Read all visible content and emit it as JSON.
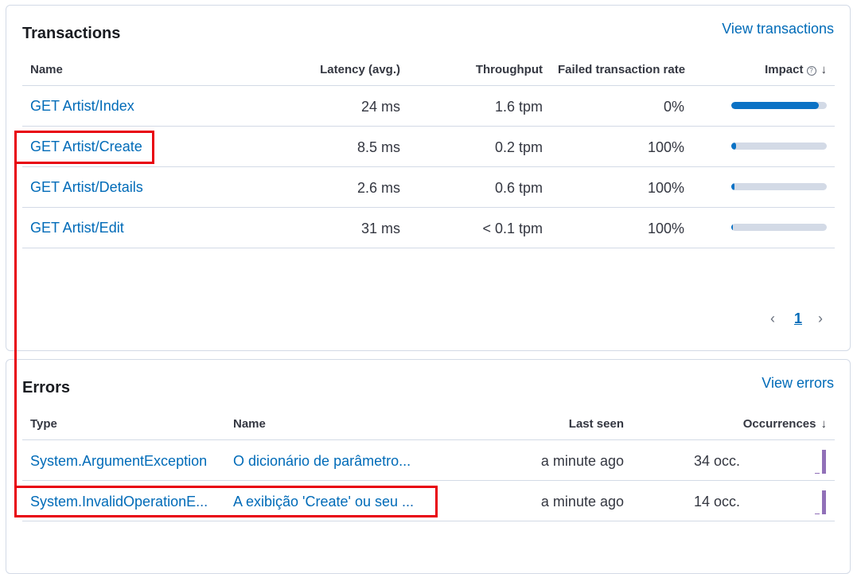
{
  "transactions": {
    "title": "Transactions",
    "view_link": "View transactions",
    "columns": {
      "name": "Name",
      "latency": "Latency (avg.)",
      "throughput": "Throughput",
      "failed_rate": "Failed transaction rate",
      "impact": "Impact"
    },
    "rows": [
      {
        "name": "GET Artist/Index",
        "latency": "24 ms",
        "throughput": "1.6 tpm",
        "failed_rate": "0%",
        "impact": 0.92
      },
      {
        "name": "GET Artist/Create",
        "latency": "8.5 ms",
        "throughput": "0.2 tpm",
        "failed_rate": "100%",
        "impact": 0.05
      },
      {
        "name": "GET Artist/Details",
        "latency": "2.6 ms",
        "throughput": "0.6 tpm",
        "failed_rate": "100%",
        "impact": 0.03
      },
      {
        "name": "GET Artist/Edit",
        "latency": "31 ms",
        "throughput": "< 0.1 tpm",
        "failed_rate": "100%",
        "impact": 0.01
      }
    ],
    "pagination": {
      "current_page": "1"
    }
  },
  "errors": {
    "title": "Errors",
    "view_link": "View errors",
    "columns": {
      "type": "Type",
      "name": "Name",
      "last_seen": "Last seen",
      "occurrences": "Occurrences"
    },
    "rows": [
      {
        "type": "System.ArgumentException",
        "name": "O dicionário de parâmetro...",
        "last_seen": "a minute ago",
        "occurrences": "34 occ."
      },
      {
        "type": "System.InvalidOperationE...",
        "name": "A exibição 'Create' ou seu ...",
        "last_seen": "a minute ago",
        "occurrences": "14 occ."
      }
    ]
  },
  "colors": {
    "link": "#006bb8",
    "impact_fill": "#0b72c5",
    "impact_track": "#d3dae6",
    "sparkline": "#9170b8",
    "annotation": "#e8000d"
  },
  "icons": {
    "impact_info": "info-icon",
    "sort_desc": "arrow-down-icon",
    "prev_page": "chevron-left-icon",
    "next_page": "chevron-right-icon"
  }
}
